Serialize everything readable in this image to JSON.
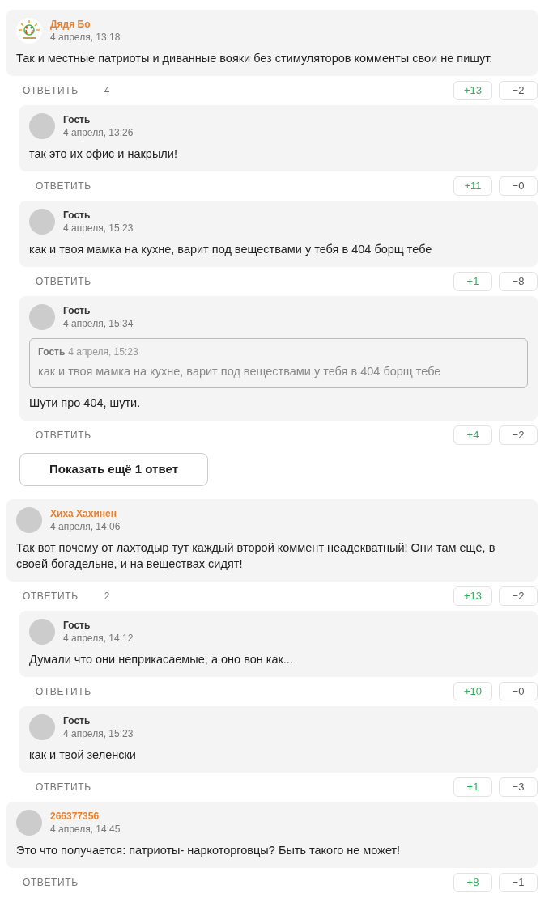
{
  "comments": [
    {
      "author": "Дядя Бо",
      "registered": true,
      "logo_avatar": true,
      "date": "4 апреля, 13:18",
      "text": "Так и местные патриоты и диванные вояки без стимуляторов комменты свои не пишут.",
      "reply_label": "ОТВЕТИТЬ",
      "reply_count": "4",
      "plus": "+13",
      "minus": "−2",
      "replies": [
        {
          "author": "Гость",
          "registered": false,
          "date": "4 апреля, 13:26",
          "text": "так это их офис и накрыли!",
          "reply_label": "ОТВЕТИТЬ",
          "plus": "+11",
          "minus": "−0"
        },
        {
          "author": "Гость",
          "registered": false,
          "date": "4 апреля, 15:23",
          "text": "как и твоя мамка на кухне, варит под веществами у тебя в 404 борщ тебе",
          "reply_label": "ОТВЕТИТЬ",
          "plus": "+1",
          "minus": "−8"
        },
        {
          "author": "Гость",
          "registered": false,
          "date": "4 апреля, 15:34",
          "quote": {
            "author": "Гость",
            "date": "4 апреля, 15:23",
            "text": "как и твоя мамка на кухне, варит под веществами у тебя в 404 борщ тебе"
          },
          "text": "Шути про 404, шути.",
          "reply_label": "ОТВЕТИТЬ",
          "plus": "+4",
          "minus": "−2"
        }
      ],
      "show_more": "Показать ещё 1 ответ"
    },
    {
      "author": "Хиха Хахинен",
      "registered": true,
      "logo_avatar": false,
      "date": "4 апреля, 14:06",
      "text": "Так вот почему от лахтодыр тут каждый второй коммент неадекватный! Они там ещё, в своей богадельне, и на веществах сидят!",
      "reply_label": "ОТВЕТИТЬ",
      "reply_count": "2",
      "plus": "+13",
      "minus": "−2",
      "replies": [
        {
          "author": "Гость",
          "registered": false,
          "date": "4 апреля, 14:12",
          "text": "Думали что они неприкасаемые, а оно вон как...",
          "reply_label": "ОТВЕТИТЬ",
          "plus": "+10",
          "minus": "−0"
        },
        {
          "author": "Гость",
          "registered": false,
          "date": "4 апреля, 15:23",
          "text": "как и твой зеленски",
          "reply_label": "ОТВЕТИТЬ",
          "plus": "+1",
          "minus": "−3"
        }
      ]
    },
    {
      "author": "266377356",
      "registered": true,
      "logo_avatar": false,
      "date": "4 апреля, 14:45",
      "text": "Это что получается: патриоты- наркоторговцы? Быть такого не может!",
      "reply_label": "ОТВЕТИТЬ",
      "plus": "+8",
      "minus": "−1"
    }
  ]
}
